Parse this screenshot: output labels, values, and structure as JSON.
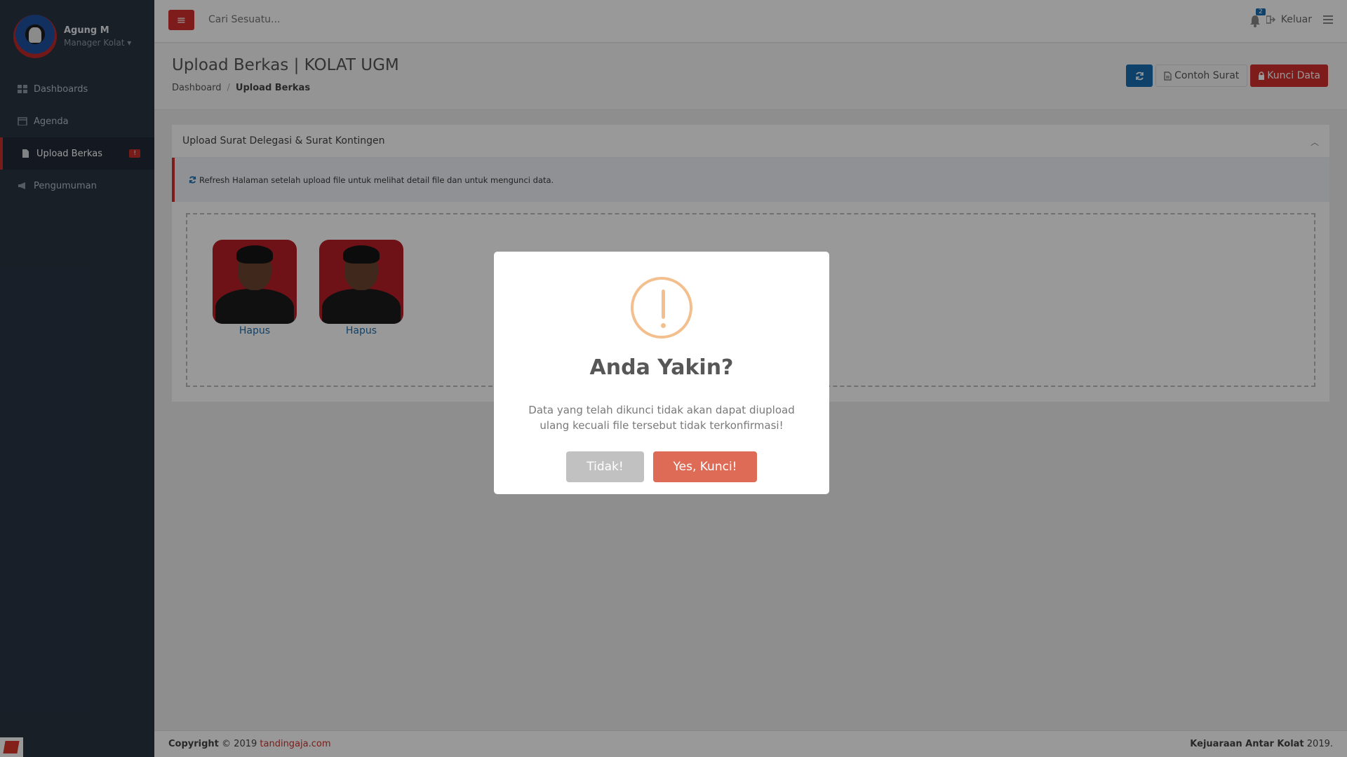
{
  "user": {
    "name": "Agung M",
    "role": "Manager Kolat"
  },
  "sidebar": {
    "items": [
      {
        "label": "Dashboards",
        "icon": "dashboard-icon"
      },
      {
        "label": "Agenda",
        "icon": "calendar-icon"
      },
      {
        "label": "Upload Berkas",
        "icon": "file-icon",
        "active": true,
        "badge": "!"
      },
      {
        "label": "Pengumuman",
        "icon": "bullhorn-icon"
      }
    ]
  },
  "topbar": {
    "search_placeholder": "Cari Sesuatu...",
    "notification_count": "2",
    "logout_label": "Keluar"
  },
  "header": {
    "title": "Upload Berkas | KOLAT UGM",
    "breadcrumb": [
      "Dashboard",
      "Upload Berkas"
    ],
    "contoh_label": "Contoh Surat",
    "kunci_label": "Kunci Data"
  },
  "panel": {
    "title": "Upload Surat Delegasi & Surat Kontingen",
    "alert": "Refresh Halaman setelah upload file untuk melihat detail file dan untuk mengunci data.",
    "files": [
      {
        "action": "Hapus"
      },
      {
        "action": "Hapus"
      }
    ]
  },
  "footer": {
    "copyright_prefix": "Copyright",
    "copyright_year": "© 2019",
    "site": "tandingaja.com",
    "right_bold": "Kejuaraan Antar Kolat",
    "right_year": "2019."
  },
  "modal": {
    "title": "Anda Yakin?",
    "text": "Data yang telah dikunci tidak akan dapat diupload ulang kecuali file tersebut tidak terkonfirmasi!",
    "cancel_label": "Tidak!",
    "confirm_label": "Yes, Kunci!"
  },
  "colors": {
    "sidebar_bg": "#2a3442",
    "accent_red": "#d0302c",
    "accent_blue": "#1a6fb2",
    "warning": "#f4bf8e",
    "confirm_button": "#dd6b55"
  }
}
